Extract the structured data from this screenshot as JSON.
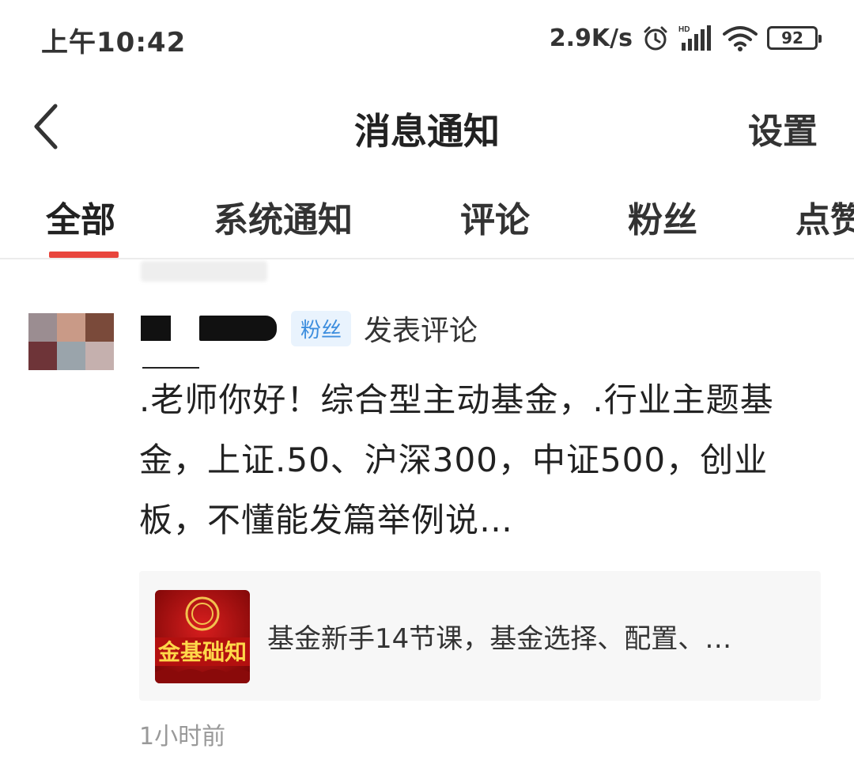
{
  "status_bar": {
    "time": "上午10:42",
    "net_speed": "2.9K/s",
    "battery": "92"
  },
  "header": {
    "title": "消息通知",
    "settings_label": "设置"
  },
  "tabs": [
    {
      "label": "全部",
      "active": true
    },
    {
      "label": "系统通知",
      "active": false
    },
    {
      "label": "评论",
      "active": false
    },
    {
      "label": "粉丝",
      "active": false
    },
    {
      "label": "点赞",
      "active": false
    }
  ],
  "notification": {
    "badge": "粉丝",
    "action": "发表评论",
    "comment": ".老师你好！综合型主动基金，.行业主题基金，上证.50、沪深300，中证500，创业板，不懂能发篇举例说…",
    "ref_thumb_text": "金基础知",
    "ref_title": "基金新手14节课，基金选择、配置、…",
    "time_ago": "1小时前"
  },
  "colors": {
    "accent": "#e8453c",
    "badge_bg": "#e9f3fd",
    "badge_text": "#3d8ede"
  }
}
